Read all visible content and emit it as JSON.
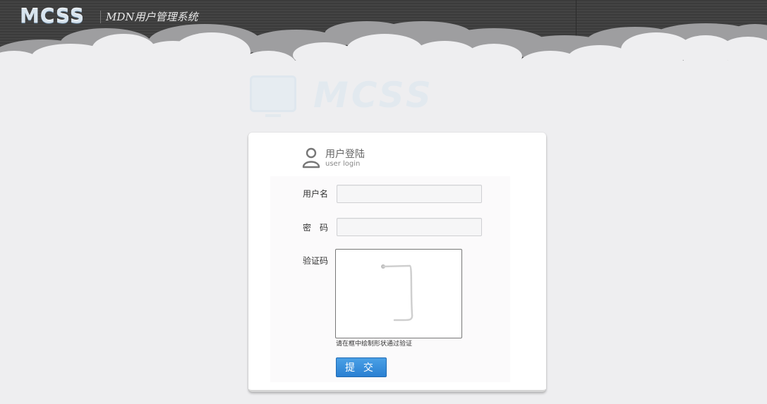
{
  "header": {
    "logo_text": "MCSS",
    "system_title": "MDN用户管理系统"
  },
  "watermark": {
    "text": "MCSS"
  },
  "login": {
    "title": "用户登陆",
    "subtitle": "user login",
    "username": {
      "label": "用户名",
      "value": "",
      "placeholder": ""
    },
    "password": {
      "label": "密　码",
      "value": "",
      "placeholder": ""
    },
    "captcha": {
      "label": "验证码",
      "hint": "请在框中绘制形状通过验证"
    },
    "submit_label": "提 交"
  },
  "icons": [
    "user-icon",
    "monitor-icon"
  ]
}
